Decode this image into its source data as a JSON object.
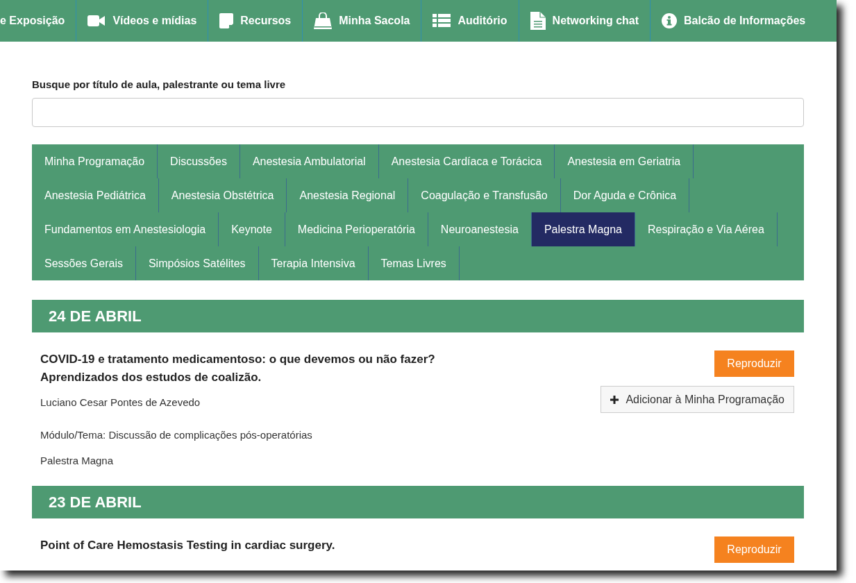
{
  "nav": [
    {
      "label": "e Exposição"
    },
    {
      "label": "Vídeos e mídias"
    },
    {
      "label": "Recursos"
    },
    {
      "label": "Minha Sacola"
    },
    {
      "label": "Auditório"
    },
    {
      "label": "Networking chat"
    },
    {
      "label": "Balcão de Informações"
    }
  ],
  "search": {
    "label": "Busque por título de aula, palestrante ou tema livre"
  },
  "categories": [
    {
      "label": "Minha Programação",
      "selected": false
    },
    {
      "label": "Discussões",
      "selected": false
    },
    {
      "label": "Anestesia Ambulatorial",
      "selected": false
    },
    {
      "label": "Anestesia Cardíaca e Torácica",
      "selected": false
    },
    {
      "label": "Anestesia em Geriatria",
      "selected": false
    },
    {
      "label": "Anestesia Pediátrica",
      "selected": false
    },
    {
      "label": "Anestesia Obstétrica",
      "selected": false
    },
    {
      "label": "Anestesia Regional",
      "selected": false
    },
    {
      "label": "Coagulação e Transfusão",
      "selected": false
    },
    {
      "label": "Dor Aguda e Crônica",
      "selected": false
    },
    {
      "label": "Fundamentos em Anestesiologia",
      "selected": false
    },
    {
      "label": "Keynote",
      "selected": false
    },
    {
      "label": "Medicina Perioperatória",
      "selected": false
    },
    {
      "label": "Neuroanestesia",
      "selected": false
    },
    {
      "label": "Palestra Magna",
      "selected": true
    },
    {
      "label": "Respiração e Via Aérea",
      "selected": false
    },
    {
      "label": "Sessões Gerais",
      "selected": false
    },
    {
      "label": "Simpósios Satélites",
      "selected": false
    },
    {
      "label": "Terapia Intensiva",
      "selected": false
    },
    {
      "label": "Temas Livres",
      "selected": false
    }
  ],
  "days": [
    {
      "date": "24 DE ABRIL",
      "sessions": [
        {
          "title": "COVID-19 e tratamento medicamentoso: o que devemos ou não fazer? Aprendizados dos estudos de coalizão.",
          "speaker": "Luciano Cesar Pontes de Azevedo",
          "module": "Módulo/Tema: Discussão de complicações pós-operatórias",
          "category": "Palestra Magna",
          "play": "Reproduzir",
          "add": "Adicionar à Minha Programação"
        }
      ]
    },
    {
      "date": "23 DE ABRIL",
      "sessions": [
        {
          "title": "Point of Care Hemostasis Testing in cardiac surgery.",
          "play": "Reproduzir"
        }
      ]
    }
  ]
}
